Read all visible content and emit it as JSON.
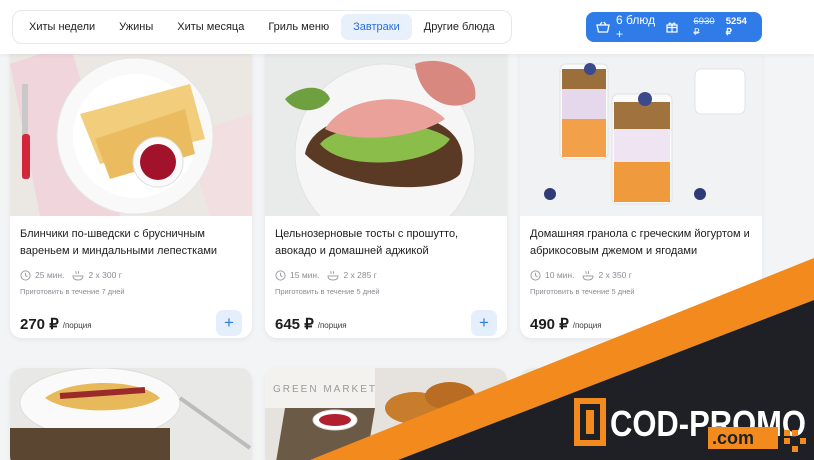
{
  "nav": {
    "tabs": [
      {
        "label": "Хиты недели"
      },
      {
        "label": "Ужины"
      },
      {
        "label": "Хиты месяца"
      },
      {
        "label": "Гриль меню"
      },
      {
        "label": "Завтраки"
      },
      {
        "label": "Другие блюда"
      }
    ],
    "active_tab": "Завтраки"
  },
  "cart": {
    "count_label": "6 блюд +",
    "old_price": "6930 ₽",
    "new_price": "5254 ₽",
    "cart_icon": "basket-icon",
    "gift_icon": "gift-icon"
  },
  "cards": [
    {
      "title": "Блинчики по-шведски с брусничным вареньем и миндальными лепестками",
      "time": "25 мин.",
      "portions": "2 x 300 г",
      "cook_within": "Приготовить в течение 7 дней",
      "price": "270 ₽",
      "unit": "/порция",
      "add_label": "+"
    },
    {
      "title": "Цельнозерновые тосты с прошутто, авокадо и домашней аджикой",
      "time": "15 мин.",
      "portions": "2 x 285 г",
      "cook_within": "Приготовить в течение 5 дней",
      "price": "645 ₽",
      "unit": "/порция",
      "add_label": "+"
    },
    {
      "title": "Домашняя гранола с греческим йогуртом и абрикосовым джемом и ягодами",
      "time": "10 мин.",
      "portions": "2 x 350 г",
      "cook_within": "Приготовить в течение 5 дней",
      "price": "490 ₽",
      "unit": "/порция",
      "add_label": "+"
    }
  ],
  "promo": {
    "brand_main": "COD-PROMO",
    "brand_sub": ".com",
    "accent_color": "#f28a1e",
    "dark_color": "#1e2026"
  },
  "lower_card_text": "GREEN MARKET"
}
